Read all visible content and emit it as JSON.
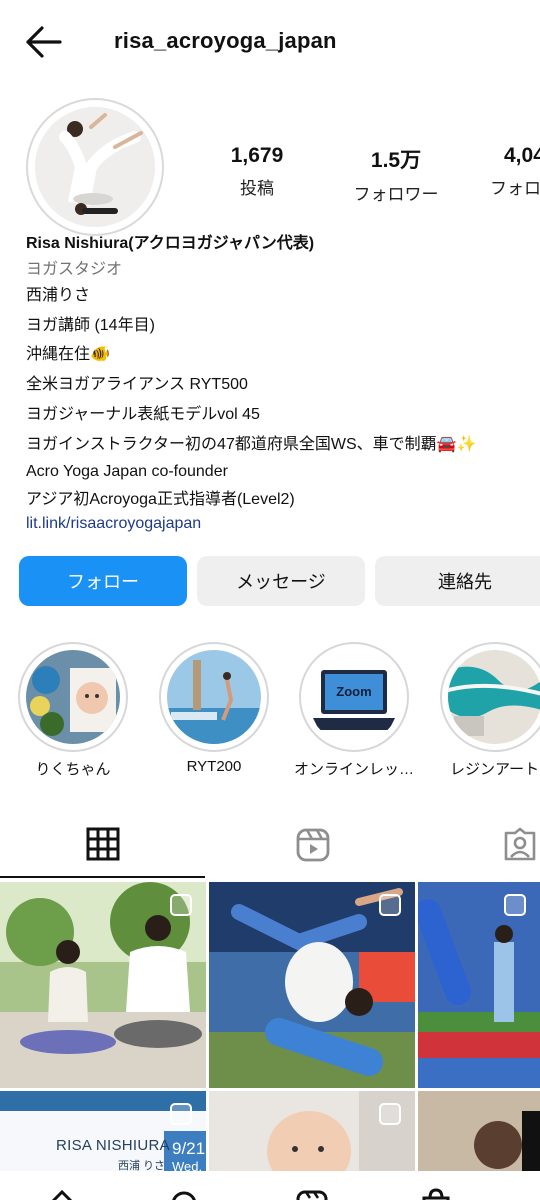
{
  "header": {
    "username": "risa_acroyoga_japan",
    "back_icon": "arrow-left-icon"
  },
  "stats": [
    {
      "value": "1,679",
      "label": "投稿"
    },
    {
      "value": "1.5万",
      "label": "フォロワー"
    },
    {
      "value": "4,04",
      "label": "フォロ"
    }
  ],
  "bio": {
    "name": "Risa Nishiura(アクロヨガジャパン代表)",
    "category": "ヨガスタジオ",
    "lines": [
      "西浦りさ",
      "ヨガ講師 (14年目)",
      "沖縄在住🐠",
      "全米ヨガアライアンス RYT500",
      "ヨガジャーナル表紙モデルvol 45",
      "ヨガインストラクター初の47都道府県全国WS、車で制覇🚘✨",
      "Acro Yoga Japan co-founder",
      "アジア初Acroyoga正式指導者(Level2)"
    ],
    "link": "lit.link/risaacroyogajapan"
  },
  "actions": {
    "follow": "フォロー",
    "message": "メッセージ",
    "contact": "連絡先"
  },
  "highlights": [
    {
      "label": "りくちゃん"
    },
    {
      "label": "RYT200"
    },
    {
      "label": "オンラインレッ…",
      "badge": "Zoom"
    },
    {
      "label": "レジンアート"
    }
  ],
  "tabs": [
    "grid-icon",
    "reels-icon",
    "tagged-icon"
  ],
  "posts": [
    {
      "caption_title": "RISA NISHIURA",
      "caption_sub": "西浦 りさ",
      "date": "9/21",
      "day": "Wed."
    }
  ],
  "colors": {
    "accent": "#1a91f5",
    "link": "#1e3a8a",
    "secondary_text": "#737373",
    "button_bg": "#efefef"
  }
}
